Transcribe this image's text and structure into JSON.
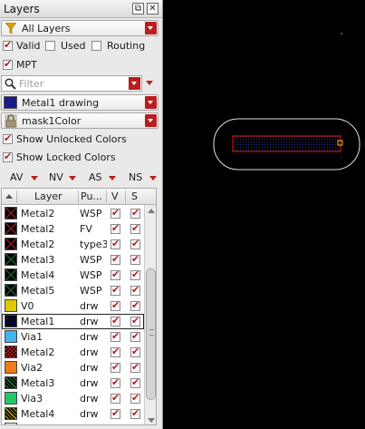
{
  "panel": {
    "title": "Layers",
    "float_icon": "float-icon",
    "close_icon": "close-icon",
    "layer_set_combo": {
      "value": "All Layers",
      "icon": "filter-funnel-icon"
    },
    "checks": [
      {
        "label": "Valid",
        "checked": true
      },
      {
        "label": "Used",
        "checked": false
      },
      {
        "label": "Routing",
        "checked": false
      }
    ],
    "mpt": {
      "label": "MPT",
      "checked": true
    },
    "filter": {
      "placeholder": "Filter",
      "icon": "search-icon"
    },
    "current_layer": {
      "value": "Metal1 drawing"
    },
    "mask_color": {
      "value": "mask1Color",
      "icon": "lock-icon"
    },
    "show_unlocked": {
      "label": "Show Unlocked Colors",
      "checked": true
    },
    "show_locked": {
      "label": "Show Locked Colors",
      "checked": true
    },
    "visibility_controls": [
      "AV",
      "NV",
      "AS",
      "NS"
    ],
    "grid": {
      "headers": [
        "Layer",
        "Pu...",
        "V",
        "S"
      ],
      "rows": [
        {
          "layer": "Metal2",
          "purpose": "WSP",
          "v": true,
          "s": true,
          "color": "#8b1a1a",
          "pattern": "x"
        },
        {
          "layer": "Metal2",
          "purpose": "FV",
          "v": true,
          "s": true,
          "color": "#8b1a1a",
          "pattern": "x"
        },
        {
          "layer": "Metal2",
          "purpose": "type3",
          "v": true,
          "s": true,
          "color": "#8b1a1a",
          "pattern": "x"
        },
        {
          "layer": "Metal3",
          "purpose": "WSP",
          "v": true,
          "s": true,
          "color": "#1c5c2c",
          "pattern": "x"
        },
        {
          "layer": "Metal4",
          "purpose": "WSP",
          "v": true,
          "s": true,
          "color": "#1c5c2c",
          "pattern": "x"
        },
        {
          "layer": "Metal5",
          "purpose": "WSP",
          "v": true,
          "s": true,
          "color": "#1c5c2c",
          "pattern": "x"
        },
        {
          "layer": "V0",
          "purpose": "drw",
          "v": true,
          "s": true,
          "color": "#e3c800",
          "pattern": "solid"
        },
        {
          "layer": "Metal1",
          "purpose": "drw",
          "v": true,
          "s": true,
          "color": "#1a1a8b",
          "pattern": "dots"
        },
        {
          "layer": "Via1",
          "purpose": "drw",
          "v": true,
          "s": true,
          "color": "#41b4f0",
          "pattern": "solid"
        },
        {
          "layer": "Metal2",
          "purpose": "drw",
          "v": true,
          "s": true,
          "color": "#c0161c",
          "pattern": "checker"
        },
        {
          "layer": "Via2",
          "purpose": "drw",
          "v": true,
          "s": true,
          "color": "#f07c18",
          "pattern": "solid"
        },
        {
          "layer": "Metal3",
          "purpose": "drw",
          "v": true,
          "s": true,
          "color": "#2a8a3a",
          "pattern": "diag"
        },
        {
          "layer": "Via3",
          "purpose": "drw",
          "v": true,
          "s": true,
          "color": "#23c86a",
          "pattern": "solid"
        },
        {
          "layer": "Metal4",
          "purpose": "drw",
          "v": true,
          "s": true,
          "color": "#c8b400",
          "pattern": "diag"
        },
        {
          "layer": "",
          "purpose": "",
          "v": true,
          "s": true,
          "color": "#ffffff",
          "pattern": "solid"
        }
      ]
    }
  },
  "canvas": {
    "outline_color": "#e0e0e0",
    "shape_color": "#e41a1a",
    "fill_color": "#1a1a8b",
    "handle_color": "#f0c000"
  }
}
